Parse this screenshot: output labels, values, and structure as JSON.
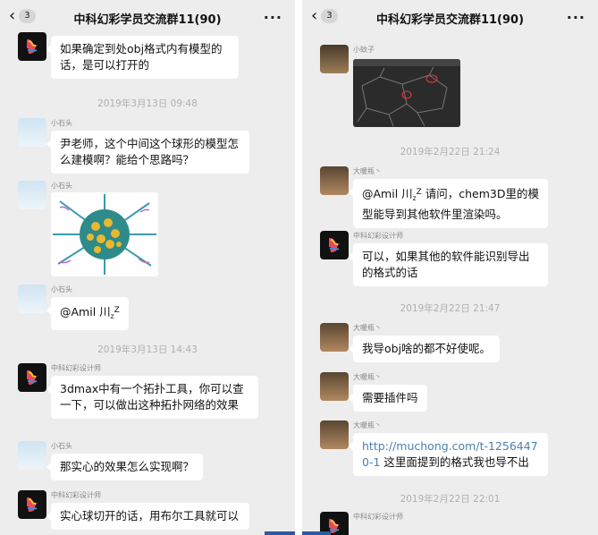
{
  "left": {
    "header": {
      "title": "中科幻彩学员交流群11(90)",
      "badge": "3",
      "back_icon": "chevron-left-icon",
      "more": "···"
    },
    "messages": [
      {
        "text": "如果确定到处obj格式内有模型的话，是可以打开的"
      },
      {
        "time": "2019年3月13日 09:48"
      },
      {
        "sender": "小石头",
        "text": "尹老师，这个中间这个球形的模型怎么建模啊？能给个思路吗？"
      },
      {
        "sender": "小石头"
      },
      {
        "sender": "小石头",
        "text_prefix": "@Amil 川",
        "zz": "z",
        "zz2": "Z"
      },
      {
        "time": "2019年3月13日 14:43"
      },
      {
        "sender": "中科幻彩设计师",
        "text": "3dmax中有一个拓扑工具，你可以查一下，可以做出这种拓扑网络的效果"
      },
      {
        "sender": "小石头",
        "text": "那实心的效果怎么实现啊？"
      },
      {
        "sender": "中科幻彩设计师",
        "text": "实心球切开的话，用布尔工具就可以"
      }
    ]
  },
  "right": {
    "header": {
      "title": "中科幻彩学员交流群11(90)",
      "badge": "3",
      "back_icon": "chevron-left-icon",
      "more": "···"
    },
    "messages": [
      {
        "sender": "小蚊子"
      },
      {
        "time": "2019年2月22日 21:24"
      },
      {
        "sender": "大暖瓶丶",
        "text_prefix": "@Amil 川",
        "zz": "z",
        "zz2": "Z",
        "text_suffix": " 请问，chem3D里的模型能导到其他软件里渲染吗。"
      },
      {
        "sender": "中科幻彩设计师",
        "text": "可以，如果其他的软件能识别导出的格式的话"
      },
      {
        "time": "2019年2月22日 21:47"
      },
      {
        "sender": "大暖瓶丶",
        "text": "我导obj啥的都不好使呢。"
      },
      {
        "sender": "大暖瓶丶",
        "text": "需要插件吗"
      },
      {
        "sender": "大暖瓶丶",
        "link": "http://muchong.com/t-12564470-1",
        "text": " 这里面提到的格式我也导不出"
      },
      {
        "time": "2019年2月22日 22:01"
      },
      {
        "sender": "中科幻彩设计师"
      }
    ]
  },
  "colors": {
    "background": "#ededed",
    "bubble": "#ffffff",
    "link": "#4a7fb3",
    "timestamp": "#b0b0b0",
    "accent_bar": "#2c5aa0"
  }
}
